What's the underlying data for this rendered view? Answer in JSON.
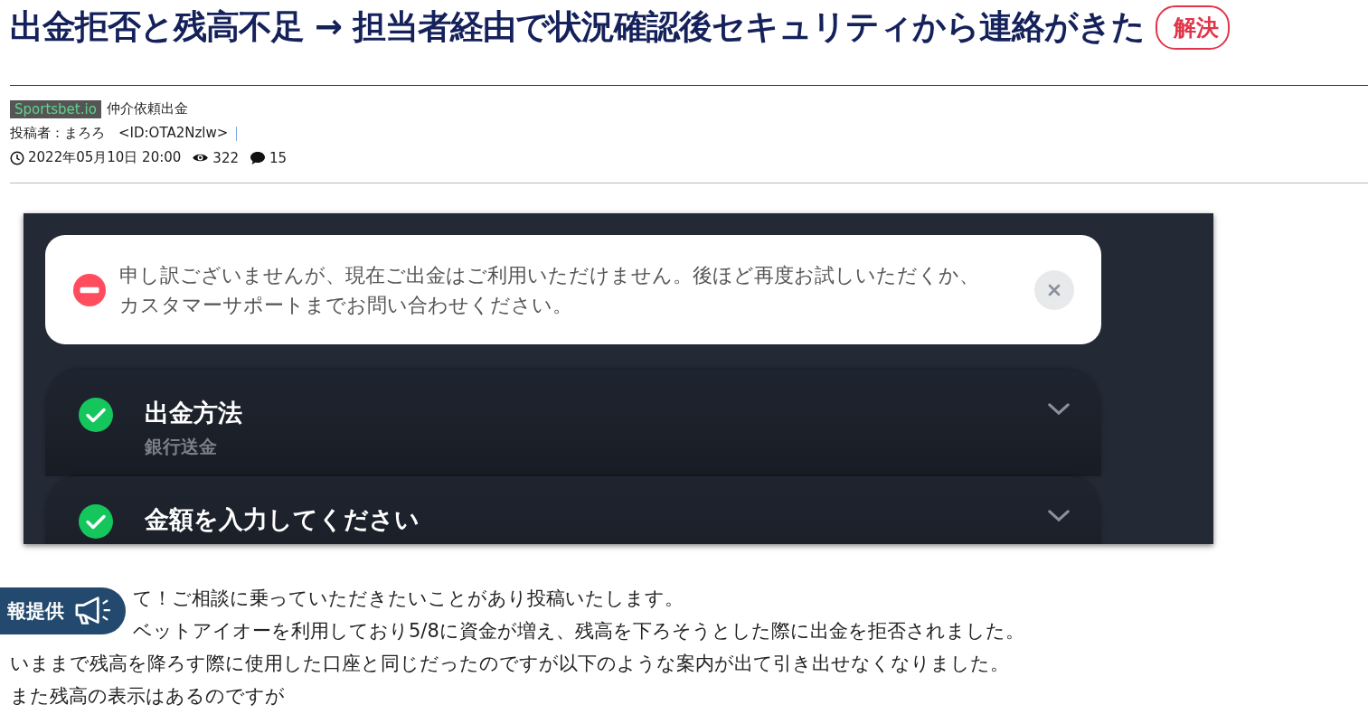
{
  "title": "出金拒否と残高不足 → 担当者経由で状況確認後セキュリティから連絡がきた",
  "status_badge": "解決",
  "category": {
    "tag": "Sportsbet.io",
    "label": "仲介依頼出金"
  },
  "poster": "投稿者：まろろ　<ID:OTA2Nzlw>",
  "date": "2022年05月10日 20:00",
  "views": "322",
  "comments": "15",
  "screenshot": {
    "alert": "申し訳ございませんが、現在ご出金はご利用いただけません。後ほど再度お試しいただくか、カスタマーサポートまでお問い合わせください。",
    "steps": [
      {
        "title": "出金方法",
        "value": "銀行送金",
        "done": true
      },
      {
        "title": "金額を入力してください",
        "done": true
      }
    ]
  },
  "body": [
    {
      "text": "て！ご相談に乗っていただきたいことがあり投稿いたします。",
      "indent": true
    },
    {
      "text": "ベットアイオーを利用しており5/8に資金が増え、残高を下ろそうとした際に出金を拒否されました。",
      "indent": true
    },
    {
      "text": "いままで残高を降ろす際に使用した口座と同じだったのですが以下のような案内が出て引き出せなくなりました。",
      "indent": false
    },
    {
      "text": "また残高の表示はあるのですが",
      "indent": false
    }
  ],
  "info_badge": "報提供"
}
